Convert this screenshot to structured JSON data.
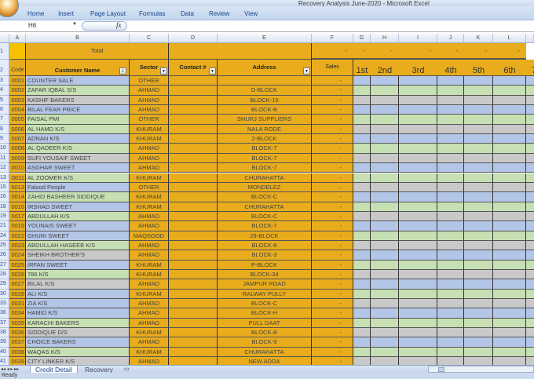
{
  "window": {
    "title": "Recovery Analysis June-2020 - Microsoft Excel"
  },
  "ribbon": {
    "tabs": [
      "Home",
      "Insert",
      "Page Layout",
      "Formulas",
      "Data",
      "Review",
      "View"
    ]
  },
  "formula_bar": {
    "name_box": "H6",
    "fx": "fx",
    "value": ""
  },
  "columns": [
    "A",
    "B",
    "C",
    "D",
    "E",
    "F",
    "G",
    "H",
    "I",
    "J",
    "K",
    "L"
  ],
  "row1": {
    "num": "1",
    "total_label": "Total",
    "dashes": [
      "-",
      "-",
      "-",
      "-",
      "-",
      "-",
      "-"
    ]
  },
  "row2": {
    "num": "2",
    "code": "Code",
    "customer": "Customer Name",
    "sector": "Sector",
    "contact": "Contact #",
    "address": "Address",
    "sales": "Sales",
    "periods": [
      "1st",
      "2nd",
      "3rd",
      "4th",
      "5th",
      "6th",
      "7"
    ]
  },
  "rows": [
    {
      "n": "3",
      "code": "0001",
      "name": "COUNTER SALE",
      "sector": "OTHER",
      "address": "",
      "sales": "-",
      "band": "blue"
    },
    {
      "n": "4",
      "code": "0002",
      "name": "ZAFAR IQBAL S/S",
      "sector": "AHMAD",
      "address": "D-BLOCK",
      "sales": "-",
      "band": "green"
    },
    {
      "n": "5",
      "code": "0003",
      "name": "KASHIF BAKERS",
      "sector": "AHMAD",
      "address": "BLOCK-15",
      "sales": "-",
      "band": "gray"
    },
    {
      "n": "6",
      "code": "0004",
      "name": "BILAL FEAR PRICE",
      "sector": "AHMAD",
      "address": "BLOCK-B",
      "sales": "-",
      "band": "blue"
    },
    {
      "n": "7",
      "code": "0005",
      "name": "FAISAL PMI",
      "sector": "OTHER",
      "address": "SHURJ SUPPLIERS",
      "sales": "-",
      "band": "green"
    },
    {
      "n": "8",
      "code": "0006",
      "name": "AL HAMD K/S",
      "sector": "KHURAM",
      "address": "NALA RODE",
      "sales": "-",
      "band": "green"
    },
    {
      "n": "9",
      "code": "0007",
      "name": "ADNAN K/S",
      "sector": "KHURAM",
      "address": "2-BLOCK",
      "sales": "-",
      "band": "blue"
    },
    {
      "n": "10",
      "code": "0008",
      "name": "AL QADEER K/S",
      "sector": "AHMAD",
      "address": "BLOCK-7",
      "sales": "-",
      "band": "green"
    },
    {
      "n": "11",
      "code": "0009",
      "name": "SUFI YOUSAIF SWEET",
      "sector": "AHMAD",
      "address": "BLOCK-7",
      "sales": "-",
      "band": "gray"
    },
    {
      "n": "12",
      "code": "0010",
      "name": "ASGHAR SWEET",
      "sector": "AHMAD",
      "address": "BLOCK-7",
      "sales": "-",
      "band": "blue"
    },
    {
      "n": "13",
      "code": "0011",
      "name": "AL ZOOMER K/S",
      "sector": "KHURAM",
      "address": "CHURAHATTA",
      "sales": "-",
      "band": "green"
    },
    {
      "n": "15",
      "code": "0013",
      "name": "Falood People",
      "sector": "OTHER",
      "address": "MONDELEZ",
      "sales": "-",
      "band": "blue"
    },
    {
      "n": "16",
      "code": "0014",
      "name": "ZAHID BASHEER SIDDIQUE",
      "sector": "KHURAM",
      "address": "BLOCK-C",
      "sales": "-",
      "band": "green"
    },
    {
      "n": "18",
      "code": "0016",
      "name": "IRSHAD SWEET",
      "sector": "KHURAM",
      "address": "CHURAHATTA",
      "sales": "-",
      "band": "blue"
    },
    {
      "n": "19",
      "code": "0017",
      "name": "ABDULLAH K/S",
      "sector": "AHMAD",
      "address": "BLOCK-C",
      "sales": "-",
      "band": "green"
    },
    {
      "n": "21",
      "code": "0019",
      "name": "YOUNAIS SWEET",
      "sector": "AHMAD",
      "address": "BLOCK-7",
      "sales": "-",
      "band": "blue"
    },
    {
      "n": "24",
      "code": "0022",
      "name": "GHURI SWEET",
      "sector": "MAQSOOD",
      "address": "29-BLOCK",
      "sales": "-",
      "band": "blue"
    },
    {
      "n": "25",
      "code": "0023",
      "name": "ABDULLAH HASEEB K/S",
      "sector": "AHMAD",
      "address": "BLOCK-8",
      "sales": "-",
      "band": "green"
    },
    {
      "n": "26",
      "code": "0024",
      "name": "SHEIKH BROTHER'S",
      "sector": "AHMAD",
      "address": "BLOCK-3",
      "sales": "-",
      "band": "gray"
    },
    {
      "n": "27",
      "code": "0025",
      "name": "IRFAN SWEET",
      "sector": "KHURAM",
      "address": "P-BLOCK",
      "sales": "-",
      "band": "blue"
    },
    {
      "n": "28",
      "code": "0026",
      "name": "786 K/S",
      "sector": "KHURAM",
      "address": "BLOCK-34",
      "sales": "-",
      "band": "green"
    },
    {
      "n": "29",
      "code": "0027",
      "name": "BILAL K/S",
      "sector": "AHMAD",
      "address": "JAMPUR ROAD",
      "sales": "-",
      "band": "gray"
    },
    {
      "n": "30",
      "code": "0028",
      "name": "ALI K/S",
      "sector": "KHURAM",
      "address": "RALWAY PULLY",
      "sales": "-",
      "band": "blue"
    },
    {
      "n": "33",
      "code": "0031",
      "name": "ZIA K/S",
      "sector": "AHMAD",
      "address": "BLOCK-C",
      "sales": "-",
      "band": "blue"
    },
    {
      "n": "36",
      "code": "0034",
      "name": "HAMID K/S",
      "sector": "AHMAD",
      "address": "BLOCK-H",
      "sales": "-",
      "band": "blue"
    },
    {
      "n": "37",
      "code": "0035",
      "name": "KARACHI BAKERS",
      "sector": "AHMAD",
      "address": "PULL DAAT",
      "sales": "-",
      "band": "green"
    },
    {
      "n": "38",
      "code": "0036",
      "name": "SIDDIQUE D/S",
      "sector": "KHURAM",
      "address": "BLOCK-B",
      "sales": "-",
      "band": "gray"
    },
    {
      "n": "39",
      "code": "0037",
      "name": "CHOICE BAKERS",
      "sector": "AHMAD",
      "address": "BLOCK-9",
      "sales": "-",
      "band": "blue"
    },
    {
      "n": "40",
      "code": "0038",
      "name": "WAQAS K/S",
      "sector": "KHURAM",
      "address": "CHURAHATTA",
      "sales": "-",
      "band": "green"
    },
    {
      "n": "41",
      "code": "0039",
      "name": "CITY LINKER K/S",
      "sector": "AHMAD",
      "address": "NEW ADDA",
      "sales": "-",
      "band": "gray"
    }
  ],
  "sheet_tabs": [
    "Credit Detail",
    "Recovery"
  ],
  "status": "Ready"
}
